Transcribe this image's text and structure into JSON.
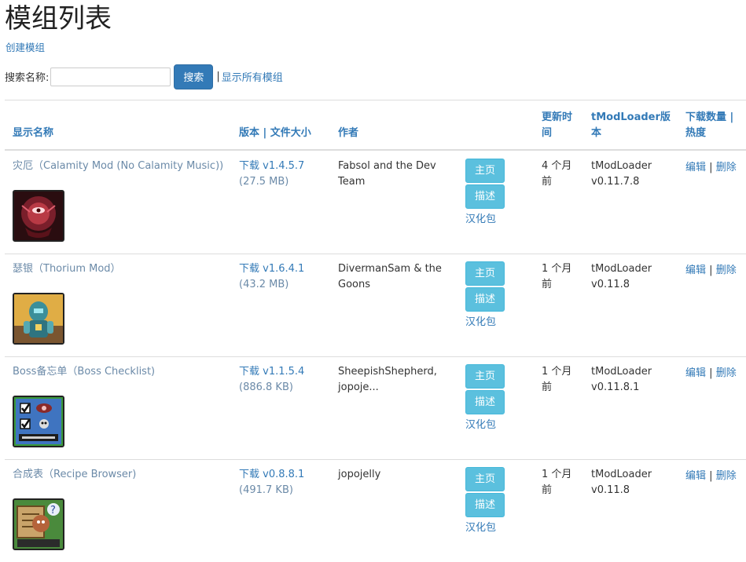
{
  "page": {
    "title": "模组列表",
    "create_link": "创建模组"
  },
  "search": {
    "label": "搜索名称:",
    "value": "",
    "placeholder": "",
    "button": "搜索",
    "separator": "|",
    "show_all": "显示所有模组"
  },
  "table": {
    "headers": {
      "name": "显示名称",
      "version": "版本 | 文件大小",
      "author": "作者",
      "updated_l1": "更新时",
      "updated_l2": "间",
      "tml_l1": "tModLoader版",
      "tml_l2": "本",
      "downloads_l1": "下载数量 |",
      "downloads_l2": "热度"
    },
    "rows": [
      {
        "name": "灾厄（Calamity Mod (No Calamity Music))",
        "download": "下载 v1.4.5.7",
        "size": "(27.5 MB)",
        "author_l1": "Fabsol and the Dev",
        "author_l2": "Team",
        "home": "主页",
        "desc": "描述",
        "zh": "汉化包",
        "updated_l1": "4 个月",
        "updated_l2": "前",
        "tml_l1": "tModLoader",
        "tml_l2": "v0.11.7.8",
        "edit": "编辑",
        "sep": "|",
        "delete": "删除"
      },
      {
        "name": "瑟银（Thorium Mod）",
        "download": "下载 v1.6.4.1",
        "size": "(43.2 MB)",
        "author_l1": "DivermanSam & the",
        "author_l2": "Goons",
        "home": "主页",
        "desc": "描述",
        "zh": "汉化包",
        "updated_l1": "1 个月",
        "updated_l2": "前",
        "tml_l1": "tModLoader",
        "tml_l2": "v0.11.8",
        "edit": "编辑",
        "sep": "|",
        "delete": "删除"
      },
      {
        "name": "Boss备忘单（Boss Checklist)",
        "download": "下载 v1.1.5.4",
        "size": "(886.8 KB)",
        "author_l1": "SheepishShepherd,",
        "author_l2": "jopoje...",
        "home": "主页",
        "desc": "描述",
        "zh": "汉化包",
        "updated_l1": "1 个月",
        "updated_l2": "前",
        "tml_l1": "tModLoader",
        "tml_l2": "v0.11.8.1",
        "edit": "编辑",
        "sep": "|",
        "delete": "删除"
      },
      {
        "name": "合成表（Recipe Browser)",
        "download": "下载 v0.8.8.1",
        "size": "(491.7 KB)",
        "author_l1": "jopojelly",
        "author_l2": "",
        "home": "主页",
        "desc": "描述",
        "zh": "汉化包",
        "updated_l1": "1 个月",
        "updated_l2": "前",
        "tml_l1": "tModLoader",
        "tml_l2": "v0.11.8",
        "edit": "编辑",
        "sep": "|",
        "delete": "删除"
      }
    ]
  },
  "icons": [
    "calamity-mod-icon",
    "thorium-mod-icon",
    "boss-checklist-icon",
    "recipe-browser-icon"
  ],
  "colors": {
    "link": "#337ab7",
    "primary_button": "#337ab7",
    "info_button": "#5bc0de",
    "border": "#dddddd"
  }
}
